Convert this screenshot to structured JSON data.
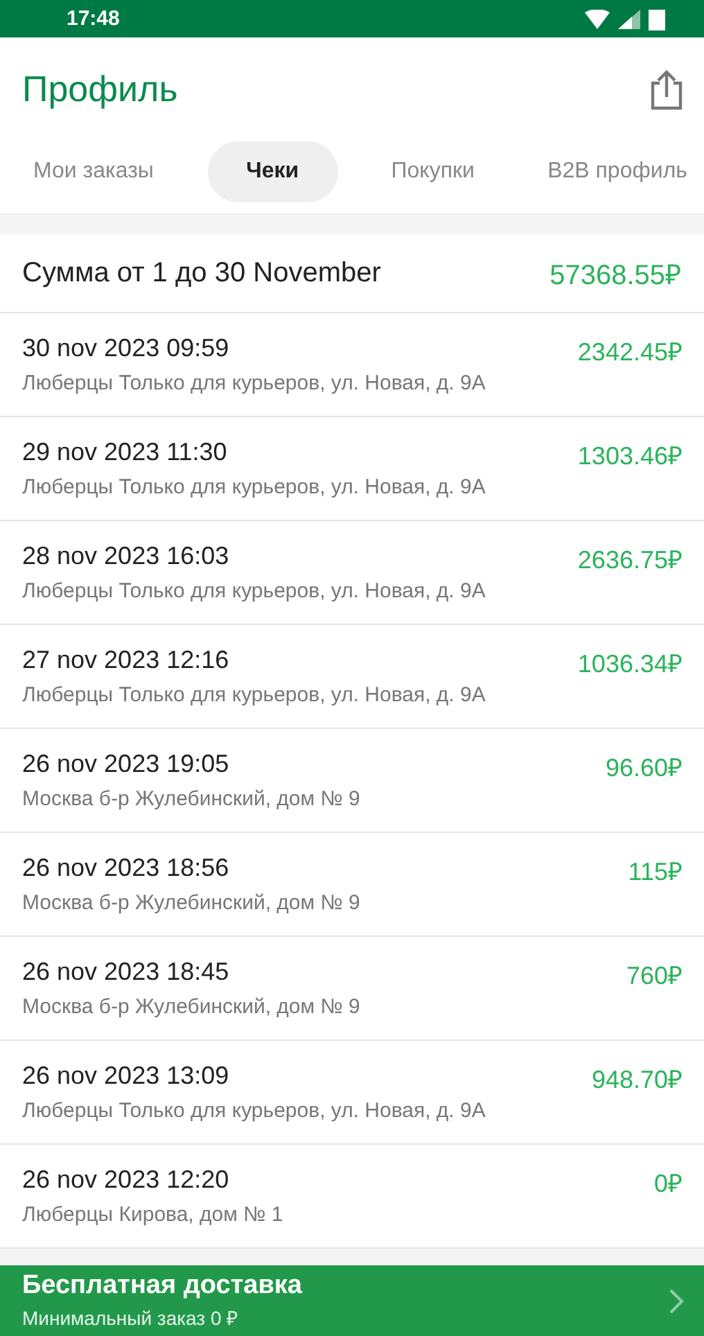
{
  "status_bar": {
    "time": "17:48"
  },
  "header": {
    "title": "Профиль"
  },
  "tabs": [
    {
      "label": "Мои заказы",
      "selected": false
    },
    {
      "label": "Чеки",
      "selected": true
    },
    {
      "label": "Покупки",
      "selected": false
    },
    {
      "label": "B2B профиль",
      "selected": false
    }
  ],
  "summary": {
    "label": "Сумма от 1 до 30 November",
    "amount": "57368.55₽"
  },
  "receipts": [
    {
      "date": "30 nov 2023 09:59",
      "address": "Люберцы Только для курьеров, ул. Новая, д. 9А",
      "amount": "2342.45₽"
    },
    {
      "date": "29 nov 2023 11:30",
      "address": "Люберцы Только для курьеров, ул. Новая, д. 9А",
      "amount": "1303.46₽"
    },
    {
      "date": "28 nov 2023 16:03",
      "address": "Люберцы Только для курьеров, ул. Новая, д. 9А",
      "amount": "2636.75₽"
    },
    {
      "date": "27 nov 2023 12:16",
      "address": "Люберцы Только для курьеров, ул. Новая, д. 9А",
      "amount": "1036.34₽"
    },
    {
      "date": "26 nov 2023 19:05",
      "address": "Москва б-р Жулебинский, дом № 9",
      "amount": "96.60₽"
    },
    {
      "date": "26 nov 2023 18:56",
      "address": "Москва б-р Жулебинский, дом № 9",
      "amount": "115₽"
    },
    {
      "date": "26 nov 2023 18:45",
      "address": "Москва б-р Жулебинский, дом № 9",
      "amount": "760₽"
    },
    {
      "date": "26 nov 2023 13:09",
      "address": "Люберцы Только для курьеров, ул. Новая, д. 9А",
      "amount": "948.70₽"
    },
    {
      "date": "26 nov 2023 12:20",
      "address": "Люберцы Кирова, дом № 1",
      "amount": "0₽"
    }
  ],
  "banner": {
    "title": "Бесплатная доставка",
    "subtitle": "Минимальный заказ 0 ₽"
  }
}
